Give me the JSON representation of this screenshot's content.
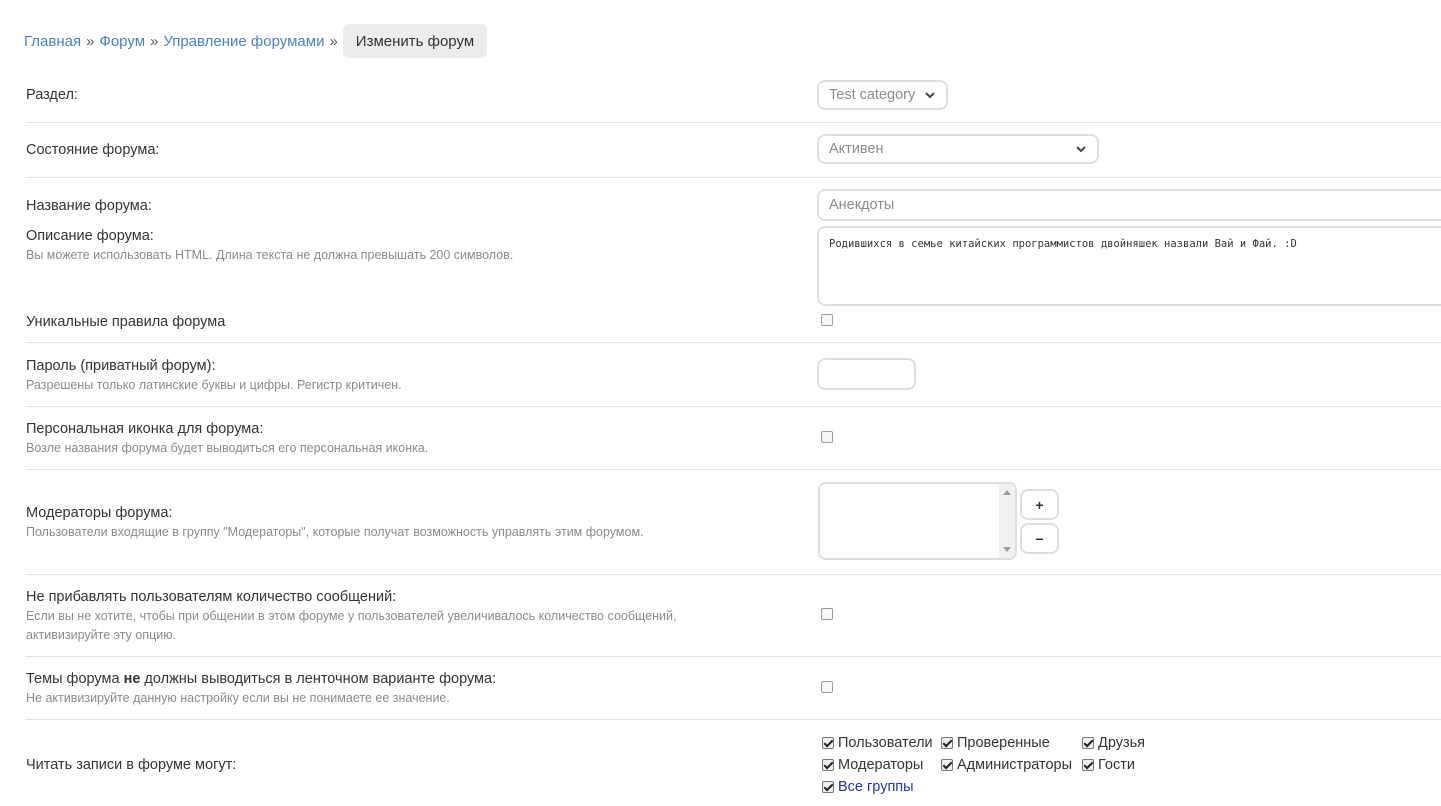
{
  "breadcrumb": {
    "items": [
      "Главная",
      "Форум",
      "Управление форумами"
    ],
    "separator": "»",
    "current": "Изменить форум"
  },
  "fields": {
    "section": {
      "label": "Раздел:",
      "value": "Test category"
    },
    "state": {
      "label": "Состояние форума:",
      "value": "Активен"
    },
    "name": {
      "label": "Название форума:",
      "placeholder": "Анекдоты"
    },
    "description": {
      "label": "Описание форума:",
      "hint": "Вы можете использовать HTML. Длина текста не должна превышать 200 символов.",
      "value": "Родившихся в семье китайских программистов двойняшек назвали Вай и Фай. :D"
    },
    "unique_rules": {
      "label": "Уникальные правила форума",
      "checked": false
    },
    "password": {
      "label": "Пароль (приватный форум):",
      "hint": "Разрешены только латинские буквы и цифры. Регистр критичен.",
      "value": ""
    },
    "icon": {
      "label": "Персональная иконка для форума:",
      "hint": "Возле названия форума будет выводиться его персональная иконка.",
      "checked": false
    },
    "moderators": {
      "label": "Модераторы форума:",
      "hint": "Пользователи входящие в группу \"Модераторы\", которые получат возможность управлять этим форумом.",
      "add_label": "+",
      "remove_label": "−"
    },
    "no_post_count": {
      "label": "Не прибавлять пользователям количество сообщений:",
      "hint_line1": "Если вы не хотите, чтобы при общении в этом форуме у пользователей увеличивалось количество сообщений,",
      "hint_line2": "активизируйте эту опцию.",
      "checked": false
    },
    "no_feed": {
      "label_before": "Темы форума ",
      "label_bold": "не",
      "label_after": " должны выводиться в ленточном варианте форума:",
      "hint": "Не активизируйте данную настройку если вы не понимаете ее значение.",
      "checked": false
    },
    "read_access": {
      "label": "Читать записи в форуме могут:",
      "groups": [
        {
          "name": "Пользователи",
          "checked": true
        },
        {
          "name": "Проверенные",
          "checked": true
        },
        {
          "name": "Друзья",
          "checked": true
        },
        {
          "name": "Модераторы",
          "checked": true
        },
        {
          "name": "Администраторы",
          "checked": true
        },
        {
          "name": "Гости",
          "checked": true
        },
        {
          "name": "Все группы",
          "checked": true
        }
      ]
    }
  },
  "colors": {
    "link": "#4a7fc1",
    "all_groups_link": "#2233aa",
    "hint": "#8a8a8a",
    "border": "#dedede"
  },
  "icons": {
    "dropdown": "chevron-down-icon",
    "listbox_scroll_up": "arrow-up-icon",
    "listbox_scroll_down": "arrow-down-icon"
  }
}
